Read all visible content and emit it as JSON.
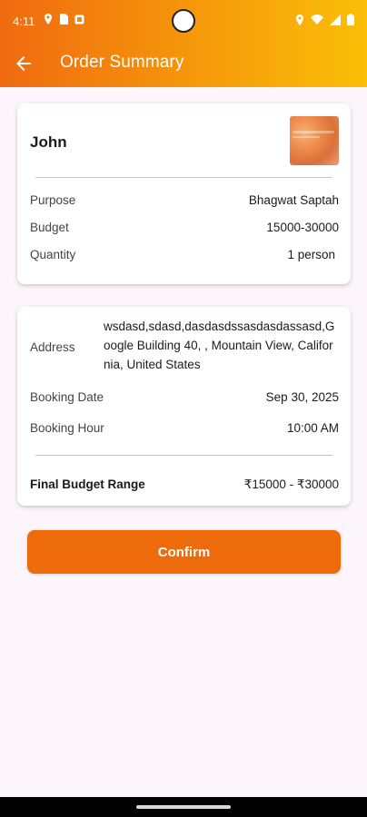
{
  "status_bar": {
    "time": "4:11",
    "left_icons": [
      "location-pin-icon",
      "sim-card-icon",
      "notification-icon"
    ],
    "right_icons": [
      "location-icon",
      "wifi-icon",
      "signal-icon",
      "battery-icon"
    ]
  },
  "app_bar": {
    "title": "Order Summary",
    "back_icon": "arrow-left-icon"
  },
  "colors": {
    "header_gradient_start": "#f06a10",
    "header_gradient_end": "#fbbf08",
    "accent": "#ee6b0c",
    "background": "#fcf5fb"
  },
  "customer_card": {
    "name": "John",
    "rows": [
      {
        "label": "Purpose",
        "value": "Bhagwat Saptah"
      },
      {
        "label": "Budget",
        "value": "15000-30000"
      },
      {
        "label": "Quantity",
        "value": "1 person"
      }
    ]
  },
  "booking_card": {
    "address_label": "Address",
    "address_value": "wsdasd,sdasd,dasdasdssasdasdassasd,Google Building 40, , Mountain View, California, United States",
    "booking_date_label": "Booking Date",
    "booking_date_value": "Sep 30, 2025",
    "booking_hour_label": "Booking Hour",
    "booking_hour_value": "10:00 AM",
    "final_budget_label": "Final Budget Range",
    "final_budget_value": "₹15000 - ₹30000"
  },
  "confirm_button": {
    "label": "Confirm"
  }
}
